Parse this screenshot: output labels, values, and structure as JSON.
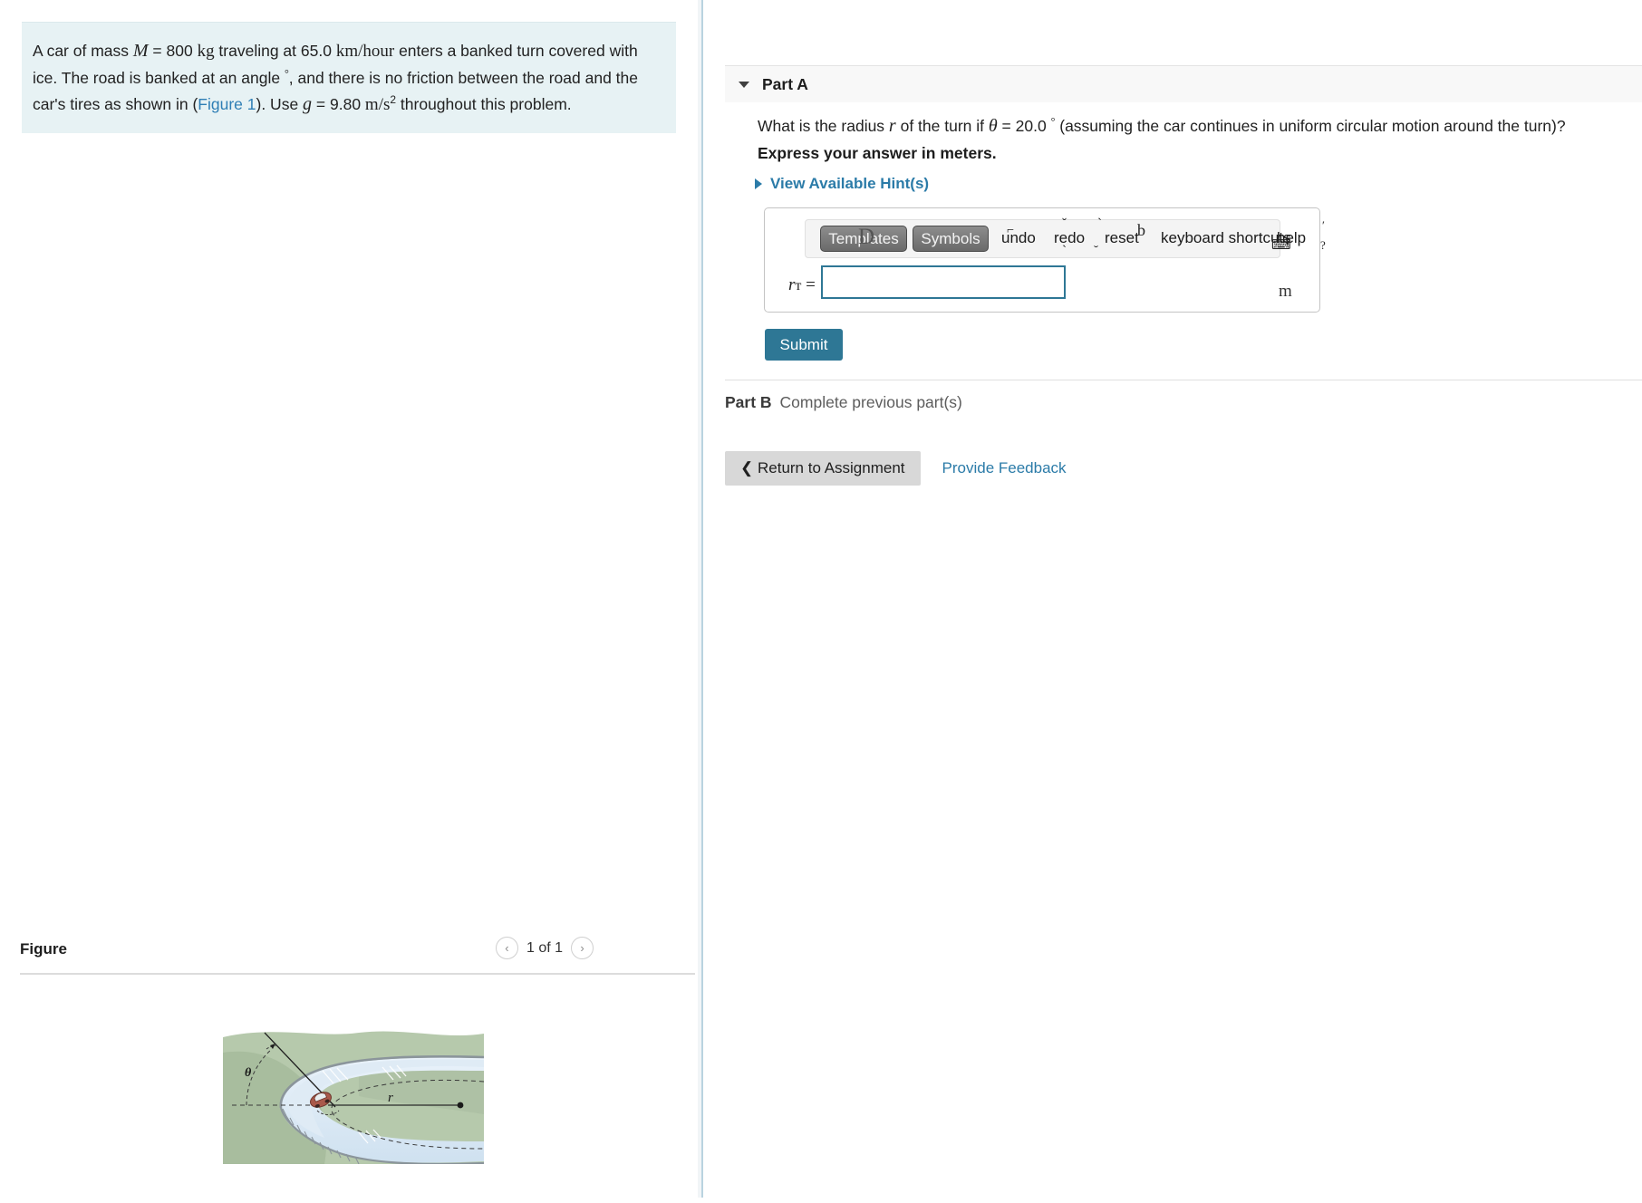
{
  "problem": {
    "text_a": "A car of mass ",
    "var_M": "M",
    "text_b": " = 800 ",
    "unit_kg": "kg",
    "text_c": " traveling at 65.0 ",
    "unit_kmh": "km/hour",
    "text_d": " enters a banked turn covered with ice. The road is banked at an angle ",
    "deg1": "°",
    "text_e": ", and there is no friction between the road and the car's tires as shown in (",
    "figure_link": "Figure 1",
    "text_f": "). Use ",
    "var_g": "g",
    "text_g": " = 9.80 ",
    "unit_ms": "m/s",
    "sup2": "2",
    "text_h": " throughout this problem."
  },
  "figure": {
    "title": "Figure",
    "pager_label": "1 of 1",
    "prev_icon": "chevron-left-icon",
    "next_icon": "chevron-right-icon",
    "theta_label": "θ",
    "radius_label": "r",
    "colors": {
      "grass": "#b6c9ac",
      "grass_shadow": "#9fb596",
      "ice": "#d7e6f2",
      "ice_light": "#e8f1f8",
      "road_edge": "#8b959b",
      "car_body": "#a9594a",
      "car_window": "#e8eef0"
    }
  },
  "part_a": {
    "header_label": "Part A",
    "caret_icon": "caret-down-icon",
    "question_1": "What is the radius ",
    "question_var_r": "r",
    "question_2": " of the turn if ",
    "question_var_theta": "θ",
    "question_3": " = 20.0 ",
    "question_deg": "°",
    "question_4": " (assuming the car continues in uniform circular motion around the turn)?",
    "express": "Express your answer in meters.",
    "hints_label": "View Available Hint(s)",
    "hints_caret_icon": "caret-right-icon"
  },
  "toolbar": {
    "templates": "Templates",
    "symbols": "Symbols",
    "undo": "undo",
    "redo": "redo",
    "reset": "reset",
    "keyboard_shortcuts": "keyboard shortcuts",
    "help": "help",
    "keyboard_icon": "keyboard-icon",
    "artifacts": [
      "D",
      "⌐",
      "ˇ",
      "ˋ",
      "b",
      "⌐",
      "ˌ",
      "˘",
      "′",
      "?"
    ]
  },
  "answer": {
    "label_r": "r",
    "label_artifact": "т",
    "equals": "=",
    "value": "",
    "placeholder": "",
    "unit": "m"
  },
  "actions": {
    "submit": "Submit",
    "return": "Return to Assignment",
    "return_icon": "chevron-left-icon",
    "feedback": "Provide Feedback"
  },
  "part_b": {
    "label": "Part B",
    "status": "Complete previous part(s)"
  },
  "colors": {
    "accent_blue": "#2b7ba8",
    "submit_bg": "#2e7795",
    "problem_bg": "#e7f2f4",
    "part_header_bg": "#f8f8f8",
    "input_border": "#2e7795"
  }
}
